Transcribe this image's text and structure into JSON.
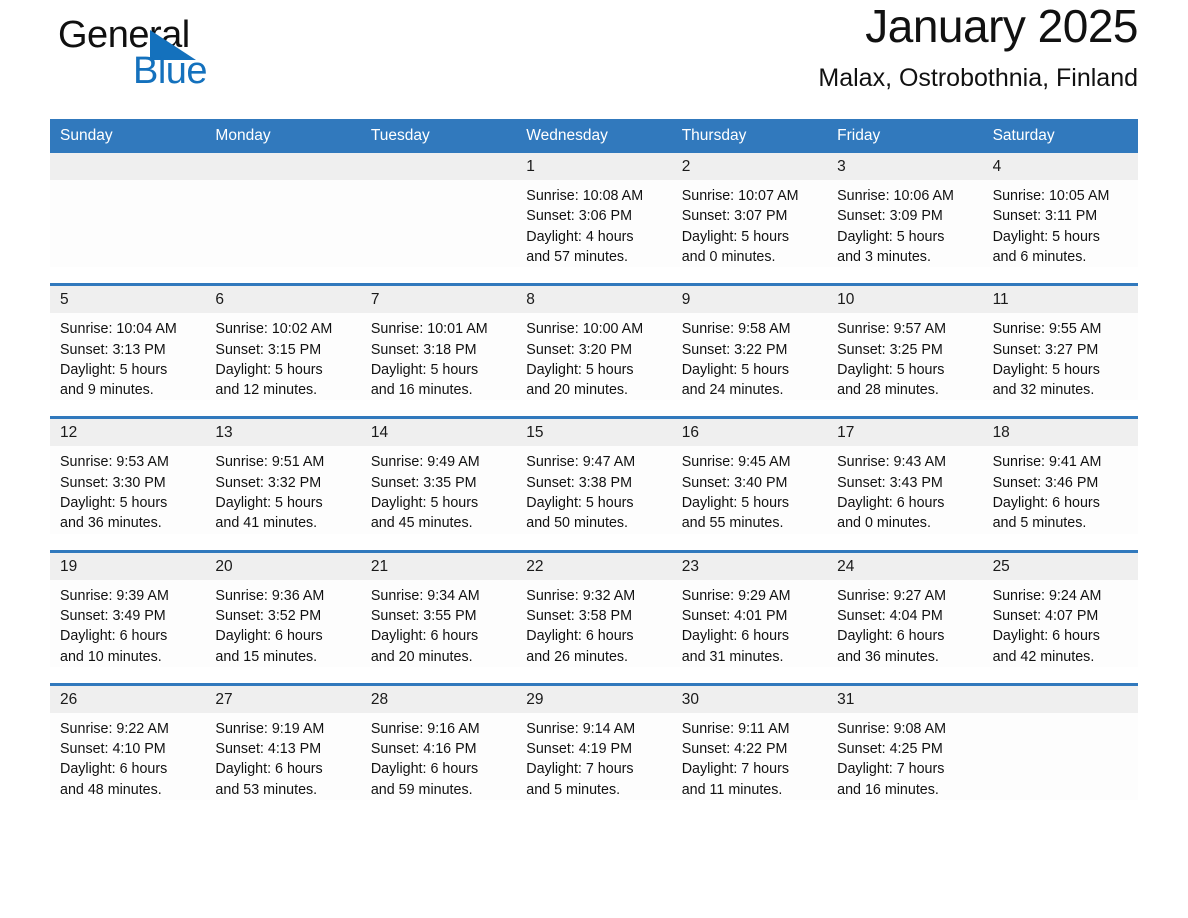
{
  "brand": {
    "name_part1": "General",
    "name_part2": "Blue",
    "triangle_icon": "triangle-icon",
    "accent_color": "#1471bd"
  },
  "header": {
    "title": "January 2025",
    "subtitle": "Malax, Ostrobothnia, Finland"
  },
  "theme": {
    "header_blue": "#3179bd",
    "day_band_gray": "#efefef",
    "text_color": "#111111"
  },
  "weekdays": [
    "Sunday",
    "Monday",
    "Tuesday",
    "Wednesday",
    "Thursday",
    "Friday",
    "Saturday"
  ],
  "weeks": [
    [
      {
        "day": "",
        "sunrise": "",
        "sunset": "",
        "daylight_line1": "",
        "daylight_line2": ""
      },
      {
        "day": "",
        "sunrise": "",
        "sunset": "",
        "daylight_line1": "",
        "daylight_line2": ""
      },
      {
        "day": "",
        "sunrise": "",
        "sunset": "",
        "daylight_line1": "",
        "daylight_line2": ""
      },
      {
        "day": "1",
        "sunrise": "Sunrise: 10:08 AM",
        "sunset": "Sunset: 3:06 PM",
        "daylight_line1": "Daylight: 4 hours",
        "daylight_line2": "and 57 minutes."
      },
      {
        "day": "2",
        "sunrise": "Sunrise: 10:07 AM",
        "sunset": "Sunset: 3:07 PM",
        "daylight_line1": "Daylight: 5 hours",
        "daylight_line2": "and 0 minutes."
      },
      {
        "day": "3",
        "sunrise": "Sunrise: 10:06 AM",
        "sunset": "Sunset: 3:09 PM",
        "daylight_line1": "Daylight: 5 hours",
        "daylight_line2": "and 3 minutes."
      },
      {
        "day": "4",
        "sunrise": "Sunrise: 10:05 AM",
        "sunset": "Sunset: 3:11 PM",
        "daylight_line1": "Daylight: 5 hours",
        "daylight_line2": "and 6 minutes."
      }
    ],
    [
      {
        "day": "5",
        "sunrise": "Sunrise: 10:04 AM",
        "sunset": "Sunset: 3:13 PM",
        "daylight_line1": "Daylight: 5 hours",
        "daylight_line2": "and 9 minutes."
      },
      {
        "day": "6",
        "sunrise": "Sunrise: 10:02 AM",
        "sunset": "Sunset: 3:15 PM",
        "daylight_line1": "Daylight: 5 hours",
        "daylight_line2": "and 12 minutes."
      },
      {
        "day": "7",
        "sunrise": "Sunrise: 10:01 AM",
        "sunset": "Sunset: 3:18 PM",
        "daylight_line1": "Daylight: 5 hours",
        "daylight_line2": "and 16 minutes."
      },
      {
        "day": "8",
        "sunrise": "Sunrise: 10:00 AM",
        "sunset": "Sunset: 3:20 PM",
        "daylight_line1": "Daylight: 5 hours",
        "daylight_line2": "and 20 minutes."
      },
      {
        "day": "9",
        "sunrise": "Sunrise: 9:58 AM",
        "sunset": "Sunset: 3:22 PM",
        "daylight_line1": "Daylight: 5 hours",
        "daylight_line2": "and 24 minutes."
      },
      {
        "day": "10",
        "sunrise": "Sunrise: 9:57 AM",
        "sunset": "Sunset: 3:25 PM",
        "daylight_line1": "Daylight: 5 hours",
        "daylight_line2": "and 28 minutes."
      },
      {
        "day": "11",
        "sunrise": "Sunrise: 9:55 AM",
        "sunset": "Sunset: 3:27 PM",
        "daylight_line1": "Daylight: 5 hours",
        "daylight_line2": "and 32 minutes."
      }
    ],
    [
      {
        "day": "12",
        "sunrise": "Sunrise: 9:53 AM",
        "sunset": "Sunset: 3:30 PM",
        "daylight_line1": "Daylight: 5 hours",
        "daylight_line2": "and 36 minutes."
      },
      {
        "day": "13",
        "sunrise": "Sunrise: 9:51 AM",
        "sunset": "Sunset: 3:32 PM",
        "daylight_line1": "Daylight: 5 hours",
        "daylight_line2": "and 41 minutes."
      },
      {
        "day": "14",
        "sunrise": "Sunrise: 9:49 AM",
        "sunset": "Sunset: 3:35 PM",
        "daylight_line1": "Daylight: 5 hours",
        "daylight_line2": "and 45 minutes."
      },
      {
        "day": "15",
        "sunrise": "Sunrise: 9:47 AM",
        "sunset": "Sunset: 3:38 PM",
        "daylight_line1": "Daylight: 5 hours",
        "daylight_line2": "and 50 minutes."
      },
      {
        "day": "16",
        "sunrise": "Sunrise: 9:45 AM",
        "sunset": "Sunset: 3:40 PM",
        "daylight_line1": "Daylight: 5 hours",
        "daylight_line2": "and 55 minutes."
      },
      {
        "day": "17",
        "sunrise": "Sunrise: 9:43 AM",
        "sunset": "Sunset: 3:43 PM",
        "daylight_line1": "Daylight: 6 hours",
        "daylight_line2": "and 0 minutes."
      },
      {
        "day": "18",
        "sunrise": "Sunrise: 9:41 AM",
        "sunset": "Sunset: 3:46 PM",
        "daylight_line1": "Daylight: 6 hours",
        "daylight_line2": "and 5 minutes."
      }
    ],
    [
      {
        "day": "19",
        "sunrise": "Sunrise: 9:39 AM",
        "sunset": "Sunset: 3:49 PM",
        "daylight_line1": "Daylight: 6 hours",
        "daylight_line2": "and 10 minutes."
      },
      {
        "day": "20",
        "sunrise": "Sunrise: 9:36 AM",
        "sunset": "Sunset: 3:52 PM",
        "daylight_line1": "Daylight: 6 hours",
        "daylight_line2": "and 15 minutes."
      },
      {
        "day": "21",
        "sunrise": "Sunrise: 9:34 AM",
        "sunset": "Sunset: 3:55 PM",
        "daylight_line1": "Daylight: 6 hours",
        "daylight_line2": "and 20 minutes."
      },
      {
        "day": "22",
        "sunrise": "Sunrise: 9:32 AM",
        "sunset": "Sunset: 3:58 PM",
        "daylight_line1": "Daylight: 6 hours",
        "daylight_line2": "and 26 minutes."
      },
      {
        "day": "23",
        "sunrise": "Sunrise: 9:29 AM",
        "sunset": "Sunset: 4:01 PM",
        "daylight_line1": "Daylight: 6 hours",
        "daylight_line2": "and 31 minutes."
      },
      {
        "day": "24",
        "sunrise": "Sunrise: 9:27 AM",
        "sunset": "Sunset: 4:04 PM",
        "daylight_line1": "Daylight: 6 hours",
        "daylight_line2": "and 36 minutes."
      },
      {
        "day": "25",
        "sunrise": "Sunrise: 9:24 AM",
        "sunset": "Sunset: 4:07 PM",
        "daylight_line1": "Daylight: 6 hours",
        "daylight_line2": "and 42 minutes."
      }
    ],
    [
      {
        "day": "26",
        "sunrise": "Sunrise: 9:22 AM",
        "sunset": "Sunset: 4:10 PM",
        "daylight_line1": "Daylight: 6 hours",
        "daylight_line2": "and 48 minutes."
      },
      {
        "day": "27",
        "sunrise": "Sunrise: 9:19 AM",
        "sunset": "Sunset: 4:13 PM",
        "daylight_line1": "Daylight: 6 hours",
        "daylight_line2": "and 53 minutes."
      },
      {
        "day": "28",
        "sunrise": "Sunrise: 9:16 AM",
        "sunset": "Sunset: 4:16 PM",
        "daylight_line1": "Daylight: 6 hours",
        "daylight_line2": "and 59 minutes."
      },
      {
        "day": "29",
        "sunrise": "Sunrise: 9:14 AM",
        "sunset": "Sunset: 4:19 PM",
        "daylight_line1": "Daylight: 7 hours",
        "daylight_line2": "and 5 minutes."
      },
      {
        "day": "30",
        "sunrise": "Sunrise: 9:11 AM",
        "sunset": "Sunset: 4:22 PM",
        "daylight_line1": "Daylight: 7 hours",
        "daylight_line2": "and 11 minutes."
      },
      {
        "day": "31",
        "sunrise": "Sunrise: 9:08 AM",
        "sunset": "Sunset: 4:25 PM",
        "daylight_line1": "Daylight: 7 hours",
        "daylight_line2": "and 16 minutes."
      },
      {
        "day": "",
        "sunrise": "",
        "sunset": "",
        "daylight_line1": "",
        "daylight_line2": ""
      }
    ]
  ]
}
